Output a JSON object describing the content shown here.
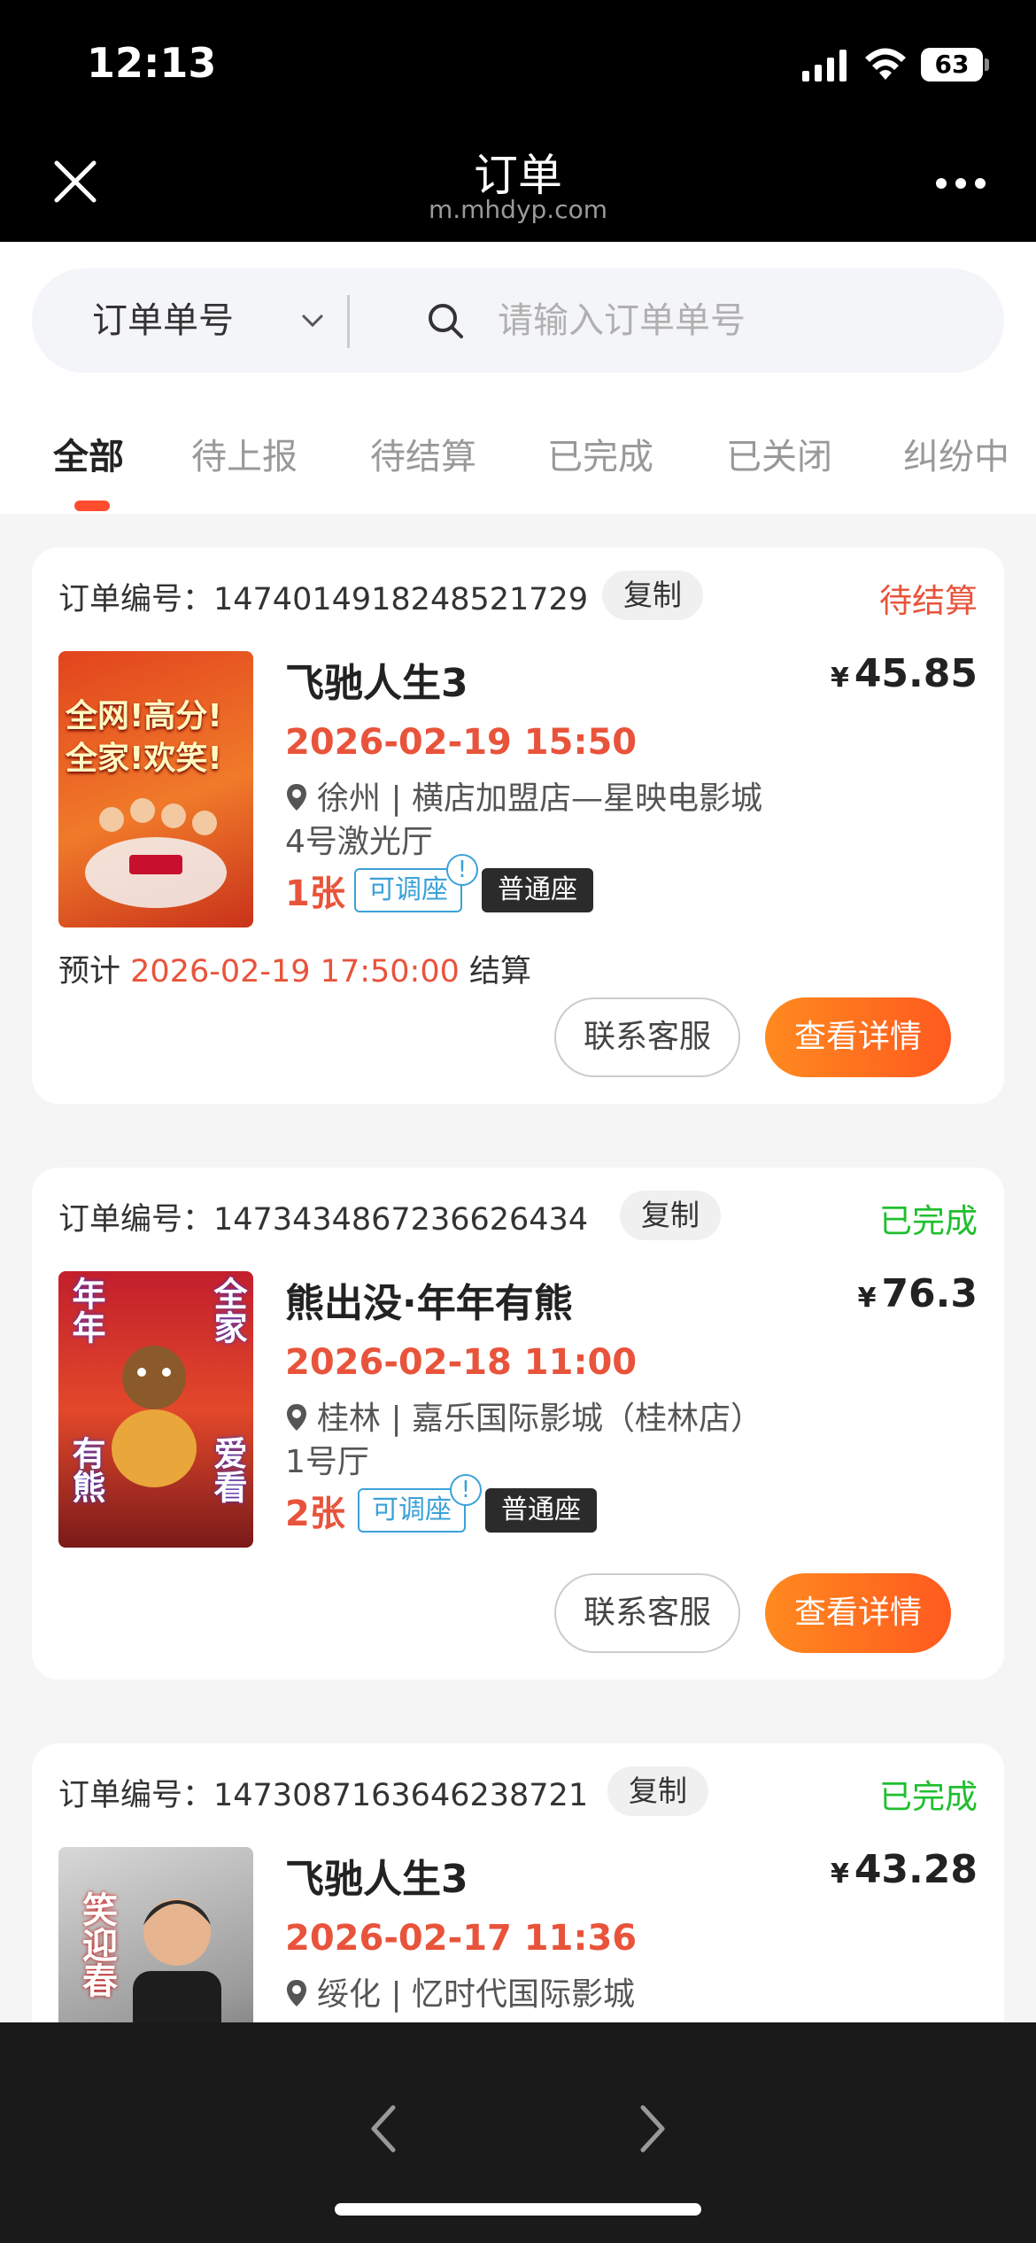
{
  "status_bar": {
    "time": "12:13",
    "battery": "63"
  },
  "nav": {
    "title": "订单",
    "subtitle": "m.mhdyp.com"
  },
  "search": {
    "type_label": "订单单号",
    "placeholder": "请输入订单单号"
  },
  "tabs": [
    "全部",
    "待上报",
    "待结算",
    "已完成",
    "已关闭",
    "纠纷中"
  ],
  "colors": {
    "accent": "#ff5a1f",
    "pending": "#e8543b",
    "done": "#1fbf2f",
    "tag_blue": "#3ba1d8"
  },
  "orders": [
    {
      "order_label": "订单编号：1474014918248521729",
      "copy": "复制",
      "status": "待结算",
      "title": "飞驰人生3",
      "price_symbol": "¥",
      "price": "45.85",
      "showtime": "2026-02-19 15:50",
      "cinema": "徐州 | 横店加盟店—星映电影城",
      "hall": "4号激光厅",
      "qty": "1张",
      "tag_adjust": "可调座",
      "tag_info": "!",
      "tag_seat": "普通座",
      "estimate_prefix": "预计",
      "estimate_time": "2026-02-19 17:50:00",
      "estimate_suffix": "结算",
      "btn_service": "联系客服",
      "btn_detail": "查看详情",
      "poster_text": [
        "全网!高分!",
        "全家!欢笑!"
      ]
    },
    {
      "order_label": "订单编号：1473434867236626434",
      "copy": "复制",
      "status": "已完成",
      "title": "熊出没·年年有熊",
      "price_symbol": "¥",
      "price": "76.3",
      "showtime": "2026-02-18 11:00",
      "cinema": "桂林 | 嘉乐国际影城（桂林店）",
      "hall": "1号厅",
      "qty": "2张",
      "tag_adjust": "可调座",
      "tag_info": "!",
      "tag_seat": "普通座",
      "btn_service": "联系客服",
      "btn_detail": "查看详情",
      "poster_text": [
        "年年",
        "全家",
        "有熊",
        "爱看"
      ]
    },
    {
      "order_label": "订单编号：1473087163646238721",
      "copy": "复制",
      "status": "已完成",
      "title": "飞驰人生3",
      "price_symbol": "¥",
      "price": "43.28",
      "showtime": "2026-02-17 11:36",
      "cinema": "绥化 | 忆时代国际影城",
      "poster_text": [
        "笑迎春"
      ]
    }
  ]
}
